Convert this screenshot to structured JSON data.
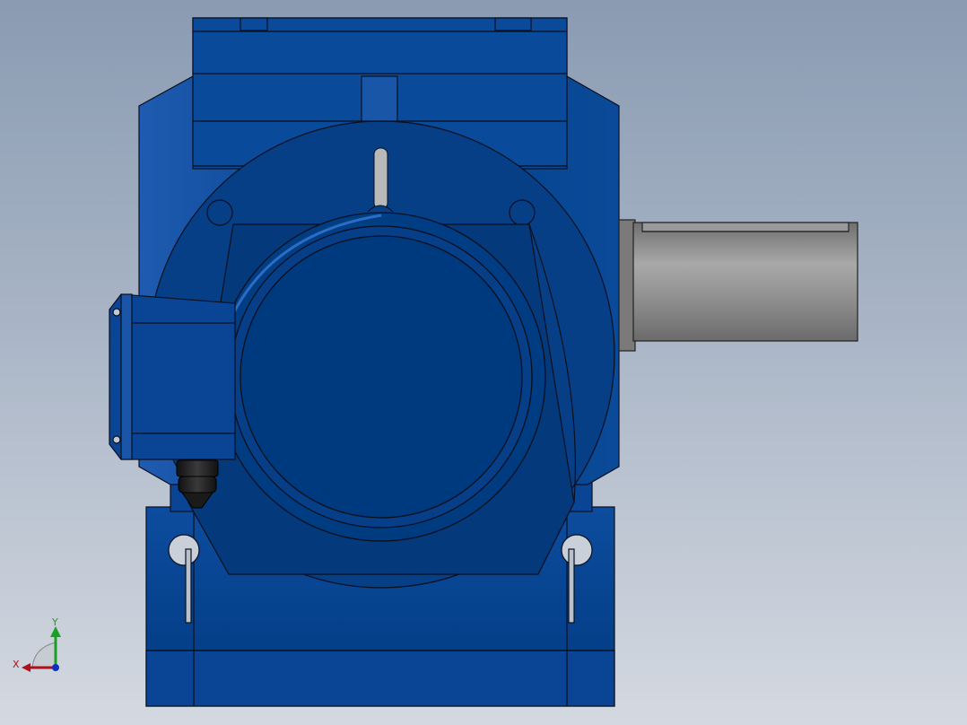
{
  "viewport": {
    "title": "",
    "colors": {
      "background_top": "#8a9bb2",
      "background_bottom": "#d4d9e1",
      "housing_blue": "#003f88",
      "housing_highlight": "#1f5bb0",
      "edge_black": "#0a0f1e",
      "shaft_gray": "#8e8e8e",
      "triad_x": "#b0101a",
      "triad_y": "#18a020",
      "triad_z": "#1030c0"
    }
  },
  "model": {
    "name": "",
    "parts": [
      "gearbox-housing",
      "motor-end-cover",
      "terminal-box",
      "cable-gland",
      "output-shaft",
      "lifting-eye",
      "foot-mount"
    ]
  },
  "triad": {
    "x_label": "X",
    "y_label": "Y",
    "icon": "coordinate-triad-icon"
  }
}
